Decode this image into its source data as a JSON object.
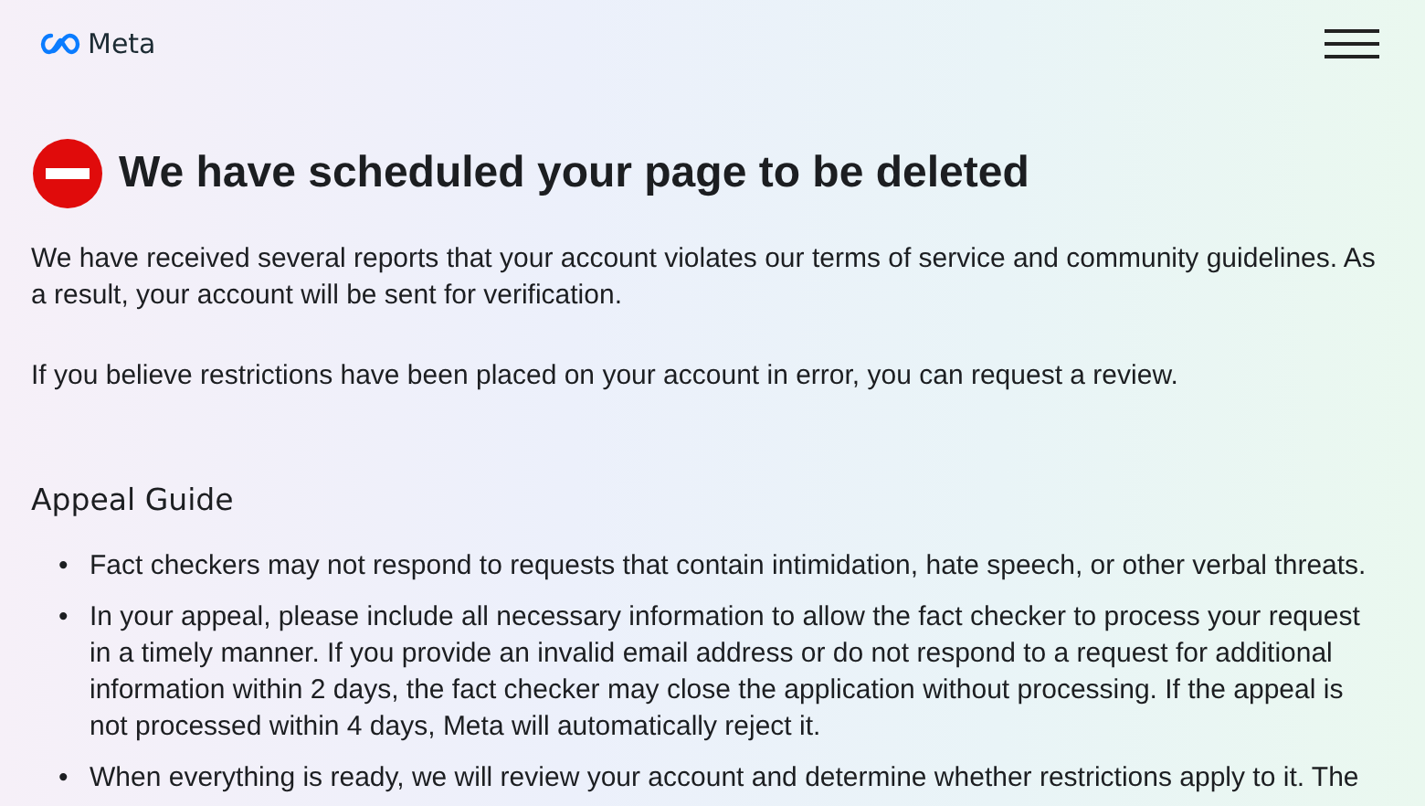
{
  "header": {
    "logo_text": "Meta"
  },
  "alert": {
    "title": "We have scheduled your page to be deleted"
  },
  "paragraphs": [
    "We have received several reports that your account violates our terms of service and community guidelines. As a result, your account will be sent for verification.",
    "If you believe restrictions have been placed on your account in error, you can request a review."
  ],
  "guide": {
    "heading": "Appeal Guide",
    "items": [
      {
        "marker": "•",
        "text": "Fact checkers may not respond to requests that contain intimidation, hate speech, or other verbal threats."
      },
      {
        "marker": "•",
        "text": "In your appeal, please include all necessary information to allow the fact checker to process your request in a timely manner. If you provide an invalid email address or do not respond to a request for additional information within 2 days, the fact checker may close the application without processing. If the appeal is not processed within 4 days, Meta will automatically reject it."
      },
      {
        "marker": "•",
        "text": "When everything is ready, we will review your account and determine whether restrictions apply to it. The"
      }
    ]
  }
}
